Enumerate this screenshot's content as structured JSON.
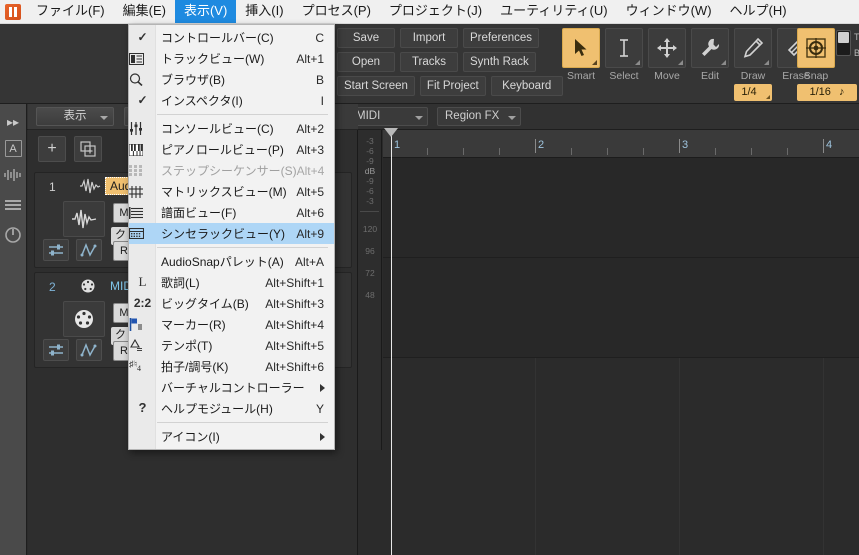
{
  "menubar": {
    "app_icon": "app-logo-icon",
    "items": [
      {
        "label": "ファイル(F)",
        "active": false
      },
      {
        "label": "編集(E)",
        "active": false
      },
      {
        "label": "表示(V)",
        "active": true
      },
      {
        "label": "挿入(I)",
        "active": false
      },
      {
        "label": "プロセス(P)",
        "active": false
      },
      {
        "label": "プロジェクト(J)",
        "active": false
      },
      {
        "label": "ユーティリティ(U)",
        "active": false
      },
      {
        "label": "ウィンドウ(W)",
        "active": false
      },
      {
        "label": "ヘルプ(H)",
        "active": false
      }
    ],
    "highlight_color": "#1e8ae0"
  },
  "view_menu": {
    "items": [
      {
        "icon": "check-icon",
        "label": "コントロールバー(C)",
        "shortcut": "C",
        "checked": true,
        "disabled": false,
        "selected": false,
        "submenu": false
      },
      {
        "icon": "track-view-icon",
        "label": "トラックビュー(W)",
        "shortcut": "Alt+1",
        "checked": false,
        "disabled": false,
        "selected": false,
        "submenu": false
      },
      {
        "icon": "browser-icon",
        "label": "ブラウザ(B)",
        "shortcut": "B",
        "checked": false,
        "disabled": false,
        "selected": false,
        "submenu": false
      },
      {
        "icon": "check-icon",
        "label": "インスペクタ(I)",
        "shortcut": "I",
        "checked": true,
        "disabled": false,
        "selected": false,
        "submenu": false
      },
      {
        "separator": true
      },
      {
        "icon": "console-icon",
        "label": "コンソールビュー(C)",
        "shortcut": "Alt+2",
        "checked": false,
        "disabled": false,
        "selected": false,
        "submenu": false
      },
      {
        "icon": "piano-roll-icon",
        "label": "ピアノロールビュー(P)",
        "shortcut": "Alt+3",
        "checked": false,
        "disabled": false,
        "selected": false,
        "submenu": false
      },
      {
        "icon": "step-sequencer-icon",
        "label": "ステップシーケンサー(S)",
        "shortcut": "Alt+4",
        "checked": false,
        "disabled": true,
        "selected": false,
        "submenu": false
      },
      {
        "icon": "matrix-icon",
        "label": "マトリックスビュー(M)",
        "shortcut": "Alt+5",
        "checked": false,
        "disabled": false,
        "selected": false,
        "submenu": false
      },
      {
        "icon": "staff-icon",
        "label": "譜面ビュー(F)",
        "shortcut": "Alt+6",
        "checked": false,
        "disabled": false,
        "selected": false,
        "submenu": false
      },
      {
        "icon": "synth-rack-icon",
        "label": "シンセラックビュー(Y)",
        "shortcut": "Alt+9",
        "checked": false,
        "disabled": false,
        "selected": true,
        "submenu": false
      },
      {
        "separator": true
      },
      {
        "icon": "",
        "label": "AudioSnapパレット(A)",
        "shortcut": "Alt+A",
        "checked": false,
        "disabled": false,
        "selected": false,
        "submenu": false
      },
      {
        "icon": "lyrics-icon",
        "label": "歌詞(L)",
        "shortcut": "Alt+Shift+1",
        "checked": false,
        "disabled": false,
        "selected": false,
        "submenu": false
      },
      {
        "icon": "big-time-icon",
        "label": "ビッグタイム(B)",
        "shortcut": "Alt+Shift+3",
        "checked": false,
        "disabled": false,
        "selected": false,
        "submenu": false
      },
      {
        "icon": "marker-icon",
        "label": "マーカー(R)",
        "shortcut": "Alt+Shift+4",
        "checked": false,
        "disabled": false,
        "selected": false,
        "submenu": false
      },
      {
        "icon": "tempo-icon",
        "label": "テンポ(T)",
        "shortcut": "Alt+Shift+5",
        "checked": false,
        "disabled": false,
        "selected": false,
        "submenu": false
      },
      {
        "icon": "key-signature-icon",
        "label": "拍子/調号(K)",
        "shortcut": "Alt+Shift+6",
        "checked": false,
        "disabled": false,
        "selected": false,
        "submenu": false
      },
      {
        "icon": "",
        "label": "バーチャルコントローラー",
        "shortcut": "",
        "checked": false,
        "disabled": false,
        "selected": false,
        "submenu": true
      },
      {
        "icon": "help-icon",
        "label": "ヘルプモジュール(H)",
        "shortcut": "Y",
        "checked": false,
        "disabled": false,
        "selected": false,
        "submenu": false
      },
      {
        "separator": true
      },
      {
        "icon": "",
        "label": "アイコン(I)",
        "shortcut": "",
        "checked": false,
        "disabled": false,
        "selected": false,
        "submenu": true
      }
    ]
  },
  "toolbar": {
    "buttons": [
      [
        "Save",
        "Import",
        "Preferences"
      ],
      [
        "Open",
        "Tracks",
        "Synth Rack"
      ],
      [
        "Start Screen",
        "Fit Project",
        "Keyboard"
      ]
    ],
    "tools": [
      {
        "label": "Smart",
        "icon": "cursor-arrow-icon",
        "selected": true
      },
      {
        "label": "Select",
        "icon": "i-beam-icon",
        "selected": false
      },
      {
        "label": "Move",
        "icon": "move-cross-icon",
        "selected": false
      },
      {
        "label": "Edit",
        "icon": "wrench-icon",
        "selected": false
      },
      {
        "label": "Draw",
        "icon": "pen-icon",
        "selected": false
      },
      {
        "label": "Erase",
        "icon": "eraser-icon",
        "selected": false
      }
    ],
    "duration_value": "1/4",
    "snap": {
      "label": "Snap",
      "icon": "snap-target-icon",
      "value": "1/16",
      "note_icon": "note-icon"
    },
    "toggle": {
      "icon": "toggle-switch-icon",
      "label_top": "T",
      "label_bottom": "B"
    },
    "accent_color": "#f0c070"
  },
  "subbar": {
    "midi_dropdown": "MIDI",
    "region_fx_dropdown": "Region FX"
  },
  "rail": {
    "icons": [
      "expand-arrows-icon",
      "letter-a-icon",
      "waveform-icon",
      "hamburger-menu-icon",
      "power-icon"
    ]
  },
  "track_pane": {
    "view_dropdown": "表示",
    "add_track_button": "add-track-icon",
    "duplicate_track_button": "duplicate-track-icon",
    "tracks": [
      {
        "number": "1",
        "name": "Audi",
        "type": "audio",
        "icon": "audio-waveform-icon",
        "mute": "M",
        "record": "R",
        "clip_label": "クリッ",
        "bottom_icons": [
          "fader-icon",
          "automation-icon"
        ]
      },
      {
        "number": "2",
        "name": "MID",
        "type": "midi",
        "icon": "midi-din-icon",
        "mute": "M",
        "record": "R",
        "clip_label": "クリッ",
        "bottom_icons": [
          "fader-icon",
          "automation-icon"
        ]
      }
    ]
  },
  "meter": {
    "top_ticks": [
      "-3",
      "-6",
      "-9"
    ],
    "unit": "dB",
    "mid_ticks": [
      "-9",
      "-6",
      "-3"
    ],
    "bottom_ticks": [
      "120",
      "96",
      "72",
      "48"
    ]
  },
  "timeline": {
    "measures": [
      "1",
      "2",
      "3",
      "4"
    ],
    "playhead_measure": "1"
  }
}
